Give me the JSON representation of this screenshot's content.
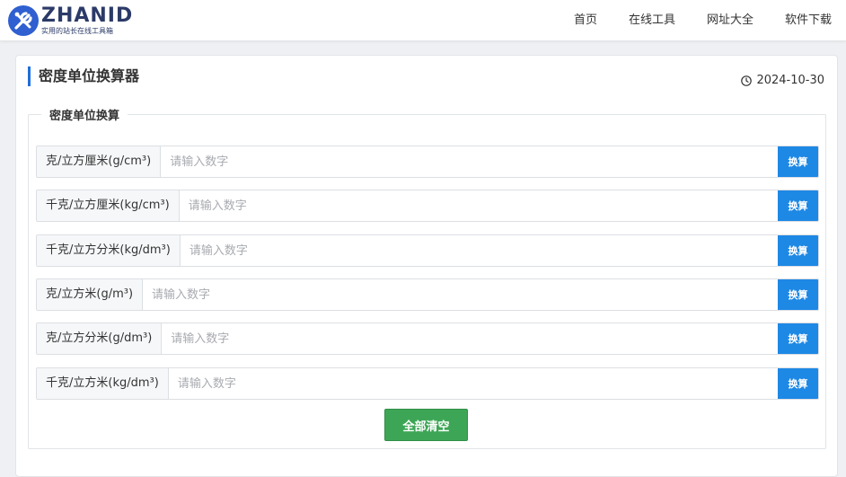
{
  "brand": {
    "name": "ZHANID",
    "tagline": "实用的站长在线工具箱",
    "colors": {
      "primary": "#2b3a67",
      "accent": "#1f6fd8"
    }
  },
  "nav": {
    "items": [
      "首页",
      "在线工具",
      "网址大全",
      "软件下载"
    ]
  },
  "page": {
    "title": "密度单位换算器",
    "date": "2024-10-30",
    "date_icon": "clock-icon"
  },
  "converter": {
    "legend": "密度单位换算",
    "placeholder": "请输入数字",
    "convert_label": "换算",
    "units": [
      "克/立方厘米(g/cm³)",
      "千克/立方厘米(kg/cm³)",
      "千克/立方分米(kg/dm³)",
      "克/立方米(g/m³)",
      "克/立方分米(g/dm³)",
      "千克/立方米(kg/dm³)"
    ],
    "clear_label": "全部清空",
    "colors": {
      "convert_button": "#1e88e5",
      "clear_button": "#3da656"
    }
  }
}
